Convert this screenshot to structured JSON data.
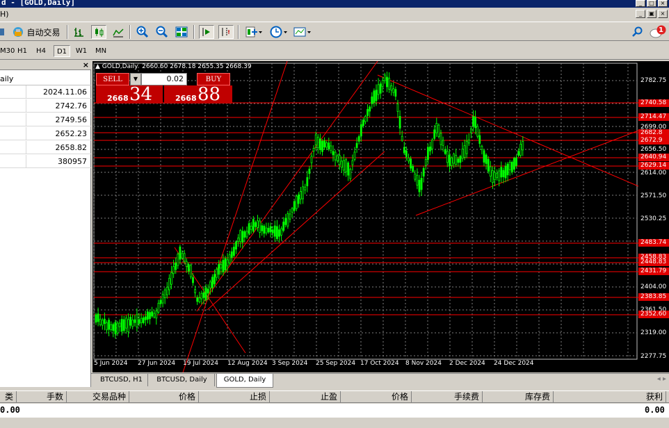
{
  "window": {
    "title": "d - [GOLD,Daily]",
    "min": "_",
    "max": "□",
    "close": "×"
  },
  "menu": {
    "help": "H)"
  },
  "toolbar": {
    "autotrade_label": "自动交易",
    "icons": [
      "new-order-icon",
      "autotrade-icon",
      "bar-chart-icon",
      "candlestick-icon",
      "line-chart-icon",
      "zoom-in-icon",
      "zoom-out-icon",
      "tile-windows-icon",
      "autoscroll-icon",
      "chart-shift-icon",
      "indicators-icon",
      "periods-icon",
      "templates-icon",
      "search-icon",
      "notification-icon"
    ],
    "notification_count": "1"
  },
  "timeframes": [
    "M30",
    "H1",
    "H4",
    "D1",
    "W1",
    "MN"
  ],
  "active_timeframe": "D1",
  "data_window": {
    "header": "aily",
    "close": "×",
    "rows": [
      "2024.11.06",
      "2742.76",
      "2749.56",
      "2652.23",
      "2658.82",
      "380957"
    ]
  },
  "chart": {
    "info": "▲ GOLD,Daily  2660.60 2678.18 2655.35 2668.39",
    "one_click": {
      "sell_label": "SELL",
      "buy_label": "BUY",
      "lot": "0.02",
      "sell_price_small": "2668",
      "sell_price_big": "34",
      "buy_price_small": "2668",
      "buy_price_big": "88"
    },
    "colors": {
      "background": "#000000",
      "candles": "#00ff00",
      "grid": "#808080",
      "lines": "#ff0000"
    },
    "price_axis": [
      "2782.75",
      "2699.00",
      "2656.50",
      "2614.00",
      "2571.50",
      "2530.25",
      "2404.00",
      "2361.50",
      "2319.00",
      "2277.75"
    ],
    "level_tags": [
      "2740.58",
      "2714.47",
      "2682.8",
      "2672.9",
      "2640.94",
      "2629.14",
      "2483.74",
      "2458.83",
      "2448.83",
      "2431.79",
      "2383.85",
      "2352.60"
    ],
    "date_axis": [
      "5 Jun 2024",
      "27 Jun 2024",
      "19 Jul 2024",
      "12 Aug 2024",
      "3 Sep 2024",
      "25 Sep 2024",
      "17 Oct 2024",
      "8 Nov 2024",
      "2 Dec 2024",
      "24 Dec 2024"
    ]
  },
  "chart_tabs": [
    "BTCUSD, H1",
    "BTCUSD, Daily",
    "GOLD, Daily"
  ],
  "active_chart_tab": "GOLD, Daily",
  "tab_nav": "◂ ▸",
  "terminal": {
    "columns": [
      "类型",
      "手数",
      "交易品种",
      "价格",
      "止损",
      "止盈",
      "价格",
      "手续费",
      "库存费",
      "获利"
    ],
    "balance_left": "0.00",
    "balance_right": "0.00"
  }
}
